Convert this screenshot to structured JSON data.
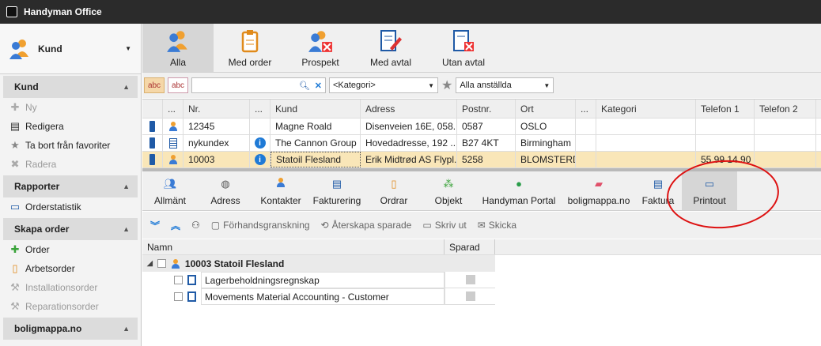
{
  "window": {
    "title": "Handyman Office"
  },
  "sidebar": {
    "module": "Kund",
    "sections": [
      {
        "title": "Kund",
        "items": [
          {
            "label": "Ny",
            "icon": "plus-icon",
            "disabled": true
          },
          {
            "label": "Redigera",
            "icon": "edit-icon",
            "disabled": false
          },
          {
            "label": "Ta bort från favoriter",
            "icon": "star-icon",
            "disabled": false
          },
          {
            "label": "Radera",
            "icon": "delete-icon",
            "disabled": true
          }
        ]
      },
      {
        "title": "Rapporter",
        "items": [
          {
            "label": "Orderstatistik",
            "icon": "printer-icon",
            "disabled": false
          }
        ]
      },
      {
        "title": "Skapa order",
        "items": [
          {
            "label": "Order",
            "icon": "plus-icon",
            "disabled": false
          },
          {
            "label": "Arbetsorder",
            "icon": "clipboard-icon",
            "disabled": false
          },
          {
            "label": "Installationsorder",
            "icon": "wrench-icon",
            "disabled": true
          },
          {
            "label": "Reparationsorder",
            "icon": "wrench-icon",
            "disabled": true
          }
        ]
      },
      {
        "title": "boligmappa.no",
        "items": []
      }
    ]
  },
  "ribbon": {
    "buttons": [
      {
        "label": "Alla",
        "icon": "people-icon",
        "active": true
      },
      {
        "label": "Med order",
        "icon": "clipboard-icon",
        "active": false
      },
      {
        "label": "Prospekt",
        "icon": "people-x-icon",
        "active": false
      },
      {
        "label": "Med avtal",
        "icon": "contract-pen-icon",
        "active": false
      },
      {
        "label": "Utan avtal",
        "icon": "contract-x-icon",
        "active": false
      }
    ]
  },
  "filter": {
    "abc1": "abc",
    "abc2": "abc",
    "search_value": "",
    "category": "<Kategori>",
    "employees": "Alla anställda"
  },
  "grid": {
    "columns": [
      "",
      "...",
      "Nr.",
      "...",
      "Kund",
      "Adress",
      "Postnr.",
      "Ort",
      "...",
      "Kategori",
      "Telefon 1",
      "Telefon 2"
    ],
    "rows": [
      {
        "nr": "12345",
        "kund": "Magne Roald",
        "adress": "Disenveien 16E, 058...",
        "postnr": "0587",
        "ort": "OSLO",
        "kategori": "",
        "telefon1": "",
        "telefon2": "",
        "info": false,
        "type": "person",
        "selected": false
      },
      {
        "nr": "nykundex",
        "kund": "The Cannon Group ...",
        "adress": "Hovedadresse, 192 ...",
        "postnr": "B27 4KT",
        "ort": "Birmingham",
        "kategori": "",
        "telefon1": "",
        "telefon2": "",
        "info": true,
        "type": "company",
        "selected": false
      },
      {
        "nr": "10003",
        "kund": "Statoil Flesland",
        "adress": "Erik Midtrød AS Flypl...",
        "postnr": "5258",
        "ort": "BLOMSTERD...",
        "kategori": "",
        "telefon1": "55 99 14 90",
        "telefon2": "",
        "info": true,
        "type": "person",
        "selected": true
      }
    ]
  },
  "tabs": [
    {
      "label": "Allmänt",
      "icon": "people-icon",
      "active": false
    },
    {
      "label": "Adress",
      "icon": "globe-icon",
      "active": false
    },
    {
      "label": "Kontakter",
      "icon": "person-icon",
      "active": false
    },
    {
      "label": "Fakturering",
      "icon": "invoice-icon",
      "active": false
    },
    {
      "label": "Ordrar",
      "icon": "clipboard-icon",
      "active": false
    },
    {
      "label": "Objekt",
      "icon": "objects-icon",
      "active": false
    },
    {
      "label": "Handyman Portal",
      "icon": "portal-globe-icon",
      "active": false
    },
    {
      "label": "boligmappa.no",
      "icon": "folder-icon",
      "active": false
    },
    {
      "label": "Faktura",
      "icon": "invoice-icon",
      "active": false
    },
    {
      "label": "Printout",
      "icon": "printer-icon",
      "active": true
    }
  ],
  "toolbar": {
    "preview": "Förhandsgranskning",
    "restore": "Återskapa sparade",
    "print": "Skriv ut",
    "send": "Skicka"
  },
  "tree": {
    "col_name": "Namn",
    "col_saved": "Sparad",
    "root": "10003 Statoil Flesland",
    "children": [
      "Lagerbeholdningsregnskap",
      "Movements Material Accounting - Customer"
    ]
  },
  "colors": {
    "titlebar": "#2b2b2b",
    "selected_row": "#f9e6b8",
    "highlight_ring": "#dd1111",
    "active_tab": "#d6d6d6"
  }
}
